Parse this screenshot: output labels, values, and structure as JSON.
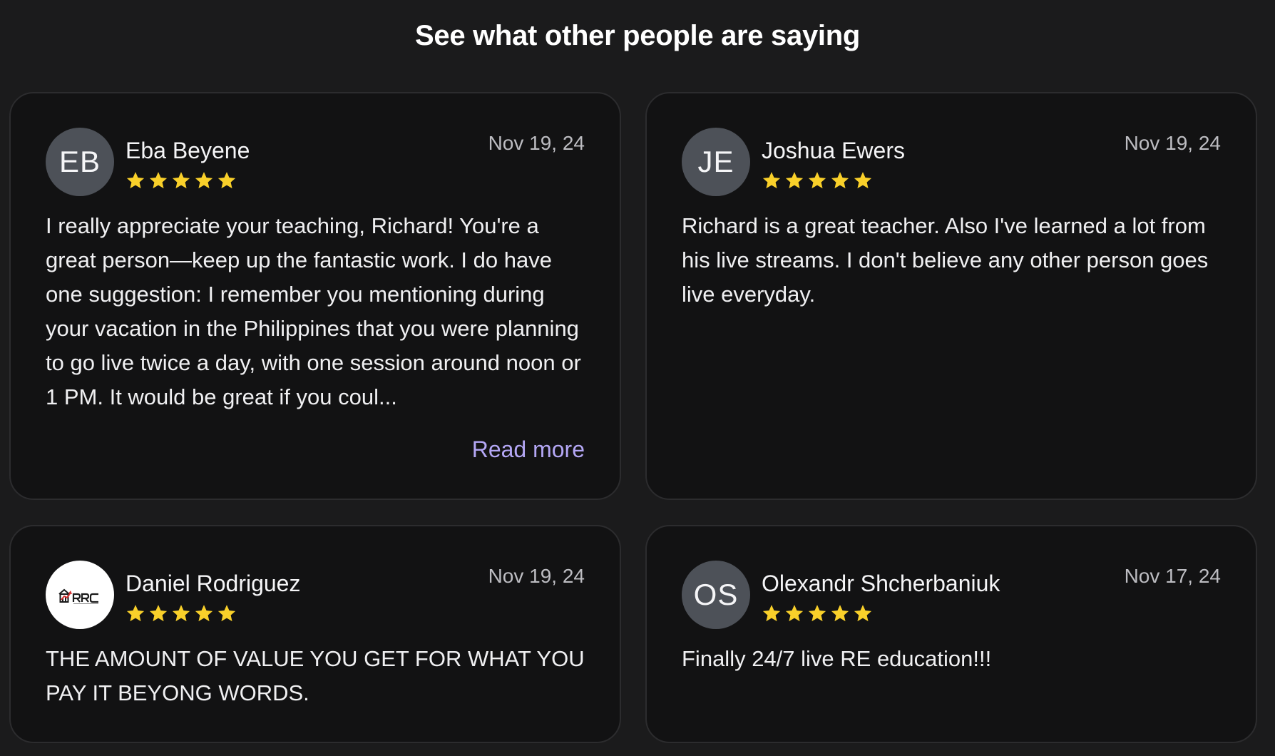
{
  "section": {
    "title": "See what other people are saying"
  },
  "colors": {
    "background": "#1b1b1c",
    "card": "#121213",
    "star": "#f9d02a",
    "link": "#b4a7f5",
    "avatar": "#4d5158"
  },
  "reviews": [
    {
      "initials": "EB",
      "name": "Eba Beyene",
      "date": "Nov 19, 24",
      "rating": 5,
      "text": "I really appreciate your teaching, Richard! You're a great person—keep up the fantastic work. I do have one suggestion: I remember you mentioning during your vacation in the Philippines that you were planning to go live twice a day, with one session around noon or 1 PM. It would be great if you coul...",
      "read_more": "Read more"
    },
    {
      "initials": "JE",
      "name": "Joshua Ewers",
      "date": "Nov 19, 24",
      "rating": 5,
      "text": "Richard is a great teacher. Also I've learned a lot from his live streams. I don't believe any other person goes live everyday."
    },
    {
      "avatar_logo": "RRC",
      "name": "Daniel Rodriguez",
      "date": "Nov 19, 24",
      "rating": 5,
      "text": "THE AMOUNT OF VALUE YOU GET FOR WHAT YOU PAY IT BEYONG WORDS."
    },
    {
      "initials": "OS",
      "name": "Olexandr Shcherbaniuk",
      "date": "Nov 17, 24",
      "rating": 5,
      "text": "Finally 24/7 live RE education!!!"
    }
  ]
}
